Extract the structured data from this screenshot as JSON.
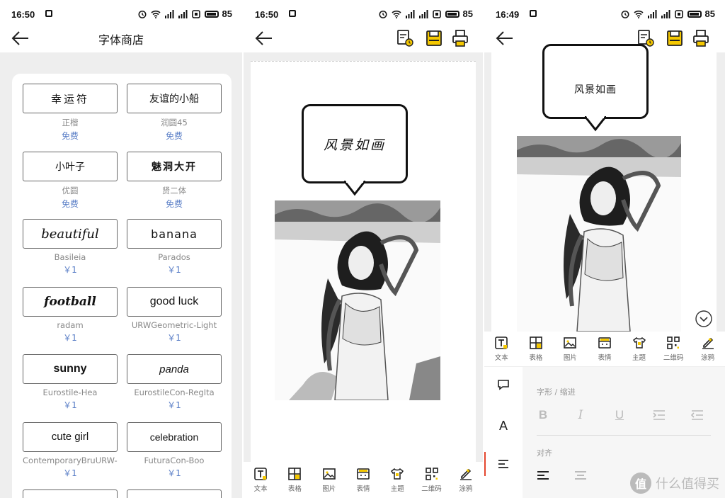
{
  "panels": {
    "store": {
      "status": {
        "time": "16:50",
        "battery": "85"
      },
      "title": "字体商店",
      "fonts": [
        {
          "preview": "幸运符",
          "name": "正楷",
          "price": "免费"
        },
        {
          "preview": "友谊的小船",
          "name": "润圆45",
          "price": "免费"
        },
        {
          "preview": "小叶子",
          "name": "优圆",
          "price": "免费"
        },
        {
          "preview": "魅洞大开",
          "name": "贤二体",
          "price": "免费"
        },
        {
          "preview": "beautiful",
          "name": "Basileia",
          "price": "￥1"
        },
        {
          "preview": "banana",
          "name": "Parados",
          "price": "￥1"
        },
        {
          "preview": "football",
          "name": "radam",
          "price": "￥1"
        },
        {
          "preview": "good luck",
          "name": "URWGeometric-Light",
          "price": "￥1"
        },
        {
          "preview": "sunny",
          "name": "Eurostile-Hea",
          "price": "￥1"
        },
        {
          "preview": "panda",
          "name": "EurostileCon-RegIta",
          "price": "￥1"
        },
        {
          "preview": "cute girl",
          "name": "ContemporaryBruURW-...",
          "price": "￥1"
        },
        {
          "preview": "celebration",
          "name": "FuturaCon-Boo",
          "price": "￥1"
        }
      ]
    },
    "editor": {
      "status": {
        "time": "16:50",
        "battery": "85"
      },
      "bubble_text": "风景如画",
      "toolbar": [
        {
          "label": "文本",
          "icon": "text-icon"
        },
        {
          "label": "表格",
          "icon": "table-icon"
        },
        {
          "label": "图片",
          "icon": "image-icon"
        },
        {
          "label": "表情",
          "icon": "emoji-icon"
        },
        {
          "label": "主题",
          "icon": "theme-icon"
        },
        {
          "label": "二维码",
          "icon": "qrcode-icon"
        },
        {
          "label": "涂鸦",
          "icon": "doodle-icon"
        }
      ]
    },
    "settings": {
      "status": {
        "time": "16:49",
        "battery": "85"
      },
      "bubble_text": "风景如画",
      "toolbar": [
        {
          "label": "文本",
          "icon": "text-icon"
        },
        {
          "label": "表格",
          "icon": "table-icon"
        },
        {
          "label": "图片",
          "icon": "image-icon"
        },
        {
          "label": "表情",
          "icon": "emoji-icon"
        },
        {
          "label": "主题",
          "icon": "theme-icon"
        },
        {
          "label": "二维码",
          "icon": "qrcode-icon"
        },
        {
          "label": "涂鸦",
          "icon": "doodle-icon"
        }
      ],
      "section_style": "字形 / 缩进",
      "section_align": "对齐",
      "format_buttons": [
        "B",
        "I",
        "U"
      ],
      "side_a": "A"
    }
  },
  "watermark": {
    "logo": "值",
    "text": "什么值得买"
  },
  "colors": {
    "price": "#5b7fc7",
    "active_marker": "#e4462e",
    "background": "#eeeeee"
  }
}
